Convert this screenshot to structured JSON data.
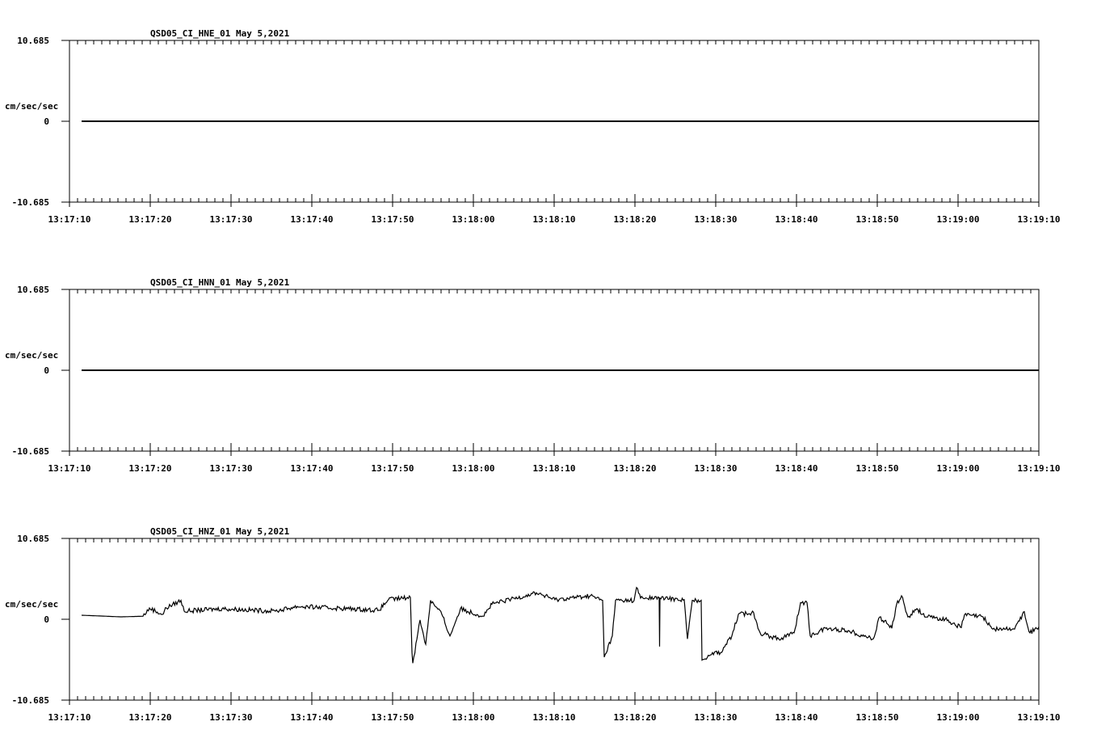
{
  "chart_data": [
    {
      "type": "line",
      "title": "QSD05_CI_HNE_01  May 5,2021",
      "ylabel": "cm/sec/sec",
      "ylim": [
        -10.685,
        10.685
      ],
      "ytick_labels": [
        "10.685",
        "0",
        "-10.685"
      ],
      "xlim_seconds": [
        0,
        120
      ],
      "xtick_labels": [
        "13:17:10",
        "13:17:20",
        "13:17:30",
        "13:17:40",
        "13:17:50",
        "13:18:00",
        "13:18:10",
        "13:18:20",
        "13:18:30",
        "13:18:40",
        "13:18:50",
        "13:19:00",
        "13:19:10"
      ],
      "series": [
        {
          "name": "HNE",
          "t": [
            1.5,
            120
          ],
          "values": [
            0,
            0
          ]
        }
      ]
    },
    {
      "type": "line",
      "title": "QSD05_CI_HNN_01  May 5,2021",
      "ylabel": "cm/sec/sec",
      "ylim": [
        -10.685,
        10.685
      ],
      "ytick_labels": [
        "10.685",
        "0",
        "-10.685"
      ],
      "xlim_seconds": [
        0,
        120
      ],
      "xtick_labels": [
        "13:17:10",
        "13:17:20",
        "13:17:30",
        "13:17:40",
        "13:17:50",
        "13:18:00",
        "13:18:10",
        "13:18:20",
        "13:18:30",
        "13:18:40",
        "13:18:50",
        "13:19:00",
        "13:19:10"
      ],
      "series": [
        {
          "name": "HNN",
          "t": [
            1.5,
            120
          ],
          "values": [
            0,
            0
          ]
        }
      ]
    },
    {
      "type": "line",
      "title": "QSD05_CI_HNZ_01  May 5,2021",
      "ylabel": "cm/sec/sec",
      "ylim": [
        -10.685,
        10.685
      ],
      "ytick_labels": [
        "10.685",
        "0",
        "-10.685"
      ],
      "xlim_seconds": [
        0,
        120
      ],
      "xtick_labels": [
        "13:17:10",
        "13:17:20",
        "13:17:30",
        "13:17:40",
        "13:17:50",
        "13:18:00",
        "13:18:10",
        "13:18:20",
        "13:18:30",
        "13:18:40",
        "13:18:50",
        "13:19:00",
        "13:19:10"
      ],
      "series": [
        {
          "name": "HNZ",
          "t": [
            1.5,
            6.4,
            9.1,
            9.9,
            11.5,
            12.0,
            13.8,
            14.2,
            18.9,
            25.5,
            28.2,
            34.4,
            38.3,
            39.5,
            42.2,
            42.4,
            42.5,
            43.4,
            44.1,
            44.7,
            46.1,
            47.1,
            48.4,
            51.2,
            52.3,
            57.8,
            60.1,
            64.5,
            66.0,
            66.2,
            67.2,
            67.6,
            69.9,
            70.2,
            70.7,
            73.0,
            73.05,
            73.1,
            76.1,
            76.5,
            77.1,
            78.2,
            78.3,
            79.6,
            80.6,
            82.0,
            82.8,
            84.7,
            85.5,
            87.8,
            89.7,
            90.5,
            91.3,
            91.7,
            93.6,
            96.4,
            99.5,
            100.3,
            101.8,
            102.4,
            103.0,
            103.8,
            104.9,
            106.1,
            108.4,
            110.4,
            110.8,
            113.1,
            114.3,
            117.0,
            118.2,
            118.9,
            120
          ],
          "values": [
            0.53,
            0.32,
            0.4,
            1.5,
            0.64,
            1.5,
            2.5,
            1.07,
            1.4,
            1.07,
            1.7,
            1.4,
            1.2,
            2.6,
            2.9,
            -4.4,
            -5.8,
            -0.1,
            -3.3,
            2.5,
            0.64,
            -2.2,
            1.4,
            0.4,
            2.0,
            3.5,
            2.6,
            3.1,
            2.5,
            -5.0,
            -2.2,
            2.5,
            2.5,
            4.2,
            2.8,
            2.8,
            -3.6,
            2.8,
            2.6,
            -2.6,
            2.5,
            2.5,
            -5.4,
            -4.4,
            -4.4,
            -2.2,
            0.64,
            0.85,
            -1.8,
            -2.6,
            -1.8,
            2.2,
            2.2,
            -2.2,
            -1.2,
            -1.5,
            -2.6,
            0.3,
            -1.2,
            2.0,
            3.1,
            0.3,
            1.4,
            0.3,
            0,
            -1.1,
            0.6,
            0.3,
            -1.3,
            -1.3,
            1.0,
            -1.8,
            -1.0
          ]
        }
      ]
    }
  ]
}
